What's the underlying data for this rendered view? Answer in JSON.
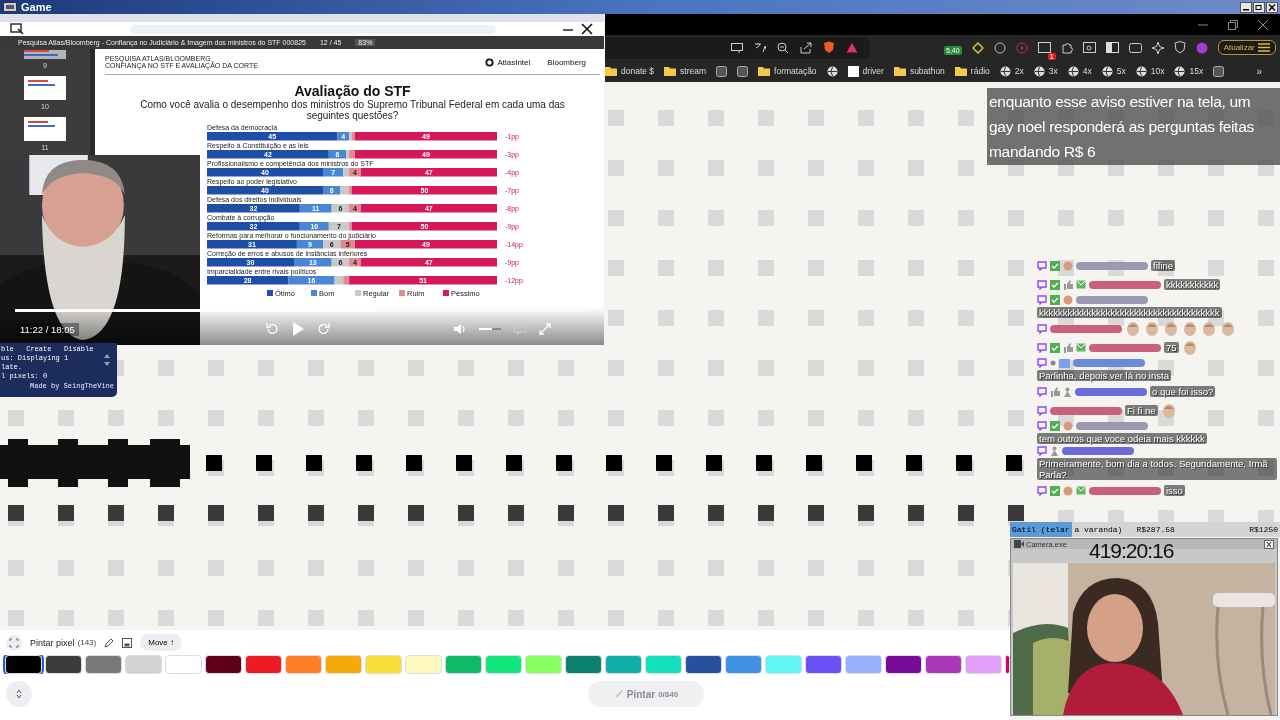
{
  "window": {
    "title": "Game"
  },
  "video": {
    "pdf": {
      "title": "Pesquisa Atlas/Bloomberg - Confiança no Judiciário & Imagem dos ministros do STF 000825",
      "page": "12 / 45",
      "zoom": "83%",
      "thumbnails": [
        {
          "label": "9"
        },
        {
          "label": "10"
        },
        {
          "label": "11"
        }
      ],
      "header_lines": [
        "PESQUISA ATLAS/BLOOMBERG",
        "CONFIANÇA NO STF E AVALIAÇÃO DA CORTE"
      ],
      "brands": [
        {
          "kind": "atlas",
          "label": "AtlasIntel"
        },
        {
          "kind": "plain",
          "label": "Bloomberg"
        }
      ],
      "heading": "Avaliação do STF",
      "subheading": "Como você avalia o desempenho dos ministros do Supremo Tribunal Federal em cada uma das seguintes questões?",
      "chart_data": {
        "type": "bar",
        "orientation": "horizontal",
        "stacked": true,
        "legend": "bottom",
        "categories": [
          "Defesa da democracia",
          "Respeito à Constituição e as leis",
          "Profissionalismo e competência dos ministros do STF",
          "Respeito ao poder legislativo",
          "Defesa dos direitos individuais",
          "Combate à corrupção",
          "Reformas para melhorar o funcionamento do judiciário",
          "Correção de erros e abusos de instâncias inferiores",
          "Imparcialidade entre rivais políticos"
        ],
        "series": [
          {
            "name": "Ótimo",
            "color": "#1e4fa6",
            "values": [
              45,
              42,
              40,
              40,
              32,
              32,
              31,
              30,
              28
            ],
            "value_labels": [
              "45",
              "42",
              "40",
              "40",
              "32",
              "32",
              "31",
              "30",
              "28"
            ]
          },
          {
            "name": "Bom",
            "color": "#4a86d6",
            "values": [
              4,
              6,
              7,
              6,
              11,
              10,
              9,
              13,
              16
            ],
            "value_labels": [
              "4",
              "6",
              "7",
              "6",
              "11",
              "10",
              "9",
              "13",
              "16"
            ]
          },
          {
            "name": "Regular",
            "color": "#c9c9c9",
            "values": [
              1,
              1,
              2,
              3,
              6,
              7,
              6,
              6,
              3
            ],
            "value_labels": [
              null,
              null,
              null,
              null,
              "6",
              "7",
              "6",
              "6",
              null
            ]
          },
          {
            "name": "Ruim",
            "color": "#e0898f",
            "values": [
              1,
              2,
              4,
              1,
              4,
              1,
              5,
              4,
              2
            ],
            "value_labels": [
              null,
              null,
              "4",
              null,
              "4",
              null,
              "5",
              "4",
              null
            ]
          },
          {
            "name": "Péssimo",
            "color": "#d6175a",
            "values": [
              49,
              49,
              47,
              50,
              47,
              50,
              49,
              47,
              51
            ],
            "value_labels": [
              "49",
              "49",
              "47",
              "50",
              "47",
              "50",
              "49",
              "47",
              "51"
            ]
          }
        ],
        "annotations": [
          "-1pp",
          "-3pp",
          "-4pp",
          "-7pp",
          "-8pp",
          "-9pp",
          "-14pp",
          "-9pp",
          "-12pp"
        ]
      }
    },
    "time": "11:22 / 18:05",
    "progress": {
      "level": 0.63
    },
    "volume": {
      "level": 0.6
    }
  },
  "browser": {
    "extension_badge": "5,40",
    "notification_count": "1",
    "update_button": "Atualizar",
    "bookmarks": [
      {
        "kind": "folder",
        "label": "donate $"
      },
      {
        "kind": "folder",
        "label": "stream"
      },
      {
        "kind": "app"
      },
      {
        "kind": "app"
      },
      {
        "kind": "folder",
        "label": "formatação"
      },
      {
        "kind": "globe"
      },
      {
        "kind": "page",
        "label": "driver"
      },
      {
        "kind": "folder",
        "label": "subathon"
      },
      {
        "kind": "folder",
        "label": "rádio"
      },
      {
        "kind": "globe",
        "label": "2x"
      },
      {
        "kind": "globe",
        "label": "3x"
      },
      {
        "kind": "globe",
        "label": "4x"
      },
      {
        "kind": "globe",
        "label": "5x"
      },
      {
        "kind": "globe",
        "label": "10x"
      },
      {
        "kind": "globe",
        "label": "15x"
      },
      {
        "kind": "app"
      }
    ],
    "overflow": "»"
  },
  "notice": "enquanto esse aviso estiver na tela, um gay noel responderá as perguntas feitas mandando R$ 6",
  "chat": [
    {
      "badges": [
        {
          "kind": "twitch"
        },
        {
          "kind": "check"
        },
        {
          "kind": "face"
        }
      ],
      "color": "#9a9ab4",
      "parts": [
        {
          "kind": "text",
          "text": "fifine"
        }
      ]
    },
    {
      "badges": [
        {
          "kind": "twitch"
        },
        {
          "kind": "check"
        },
        {
          "kind": "thumb"
        },
        {
          "kind": "mail"
        }
      ],
      "color": "#c8607e",
      "parts": [
        {
          "kind": "text",
          "text": "kkkkkkkkkkk"
        }
      ]
    },
    {
      "badges": [
        {
          "kind": "twitch"
        },
        {
          "kind": "check"
        },
        {
          "kind": "face"
        }
      ],
      "color": "#9a9ab4",
      "parts": [
        {
          "kind": "text",
          "text": "kkkkkkkkkkkkkkkkkkkkkkkkkkkkkkkkkkkkkk"
        }
      ]
    },
    {
      "badges": [
        {
          "kind": "twitch"
        }
      ],
      "color": "#c8607e",
      "parts": [
        {
          "kind": "emote"
        },
        {
          "kind": "emote"
        },
        {
          "kind": "emote"
        },
        {
          "kind": "emote"
        },
        {
          "kind": "emote"
        },
        {
          "kind": "emote"
        }
      ]
    },
    {
      "badges": [
        {
          "kind": "twitch"
        },
        {
          "kind": "check"
        },
        {
          "kind": "thumb"
        },
        {
          "kind": "mail"
        }
      ],
      "color": "#c8607e",
      "parts": [
        {
          "kind": "text",
          "text": "75"
        },
        {
          "kind": "emote"
        }
      ]
    },
    {
      "badges": [
        {
          "kind": "twitch"
        },
        {
          "kind": "dot"
        },
        {
          "kind": "chat"
        }
      ],
      "color": "#6c8ad8",
      "parts": [
        {
          "kind": "text",
          "text": "Parlinha, depois ver lá no insta"
        }
      ]
    },
    {
      "badges": [
        {
          "kind": "twitch"
        },
        {
          "kind": "thumb"
        },
        {
          "kind": "figure"
        }
      ],
      "color": "#6a6ad8",
      "parts": [
        {
          "kind": "text",
          "text": "o que foi isso?"
        }
      ]
    },
    {
      "badges": [
        {
          "kind": "twitch"
        }
      ],
      "color": "#c8607e",
      "parts": [
        {
          "kind": "text",
          "text": "Fi fi ne"
        },
        {
          "kind": "emote"
        }
      ]
    },
    {
      "badges": [
        {
          "kind": "twitch"
        },
        {
          "kind": "check"
        },
        {
          "kind": "face"
        }
      ],
      "color": "#9a9ab4",
      "parts": [
        {
          "kind": "text",
          "text": "tem outros que voce odeia mais kkkkkk"
        }
      ]
    },
    {
      "badges": [
        {
          "kind": "twitch"
        },
        {
          "kind": "figure"
        }
      ],
      "color": "#6a6ad8",
      "parts": [
        {
          "kind": "text",
          "text": "Primeiramente, bom dia a todos. Segundamente, Irmã Parla?"
        }
      ]
    },
    {
      "badges": [
        {
          "kind": "twitch"
        },
        {
          "kind": "check"
        },
        {
          "kind": "face"
        },
        {
          "kind": "mail"
        }
      ],
      "color": "#c8607e",
      "parts": [
        {
          "kind": "text",
          "text": "isso"
        }
      ]
    }
  ],
  "script_panel": {
    "lines": [
      "ble   Create   Disable",
      "us: Displaying 1",
      "late.",
      "l pixels: 0"
    ],
    "credit": "Made by SeingTheVine"
  },
  "paint_bar": {
    "mode": "Pintar pixel",
    "count": "(143)",
    "move_button": "Move ↑",
    "swatches": [
      {
        "color": "#000000",
        "selected": true
      },
      {
        "color": "#3c3c3c",
        "selected": false
      },
      {
        "color": "#787878",
        "selected": false
      },
      {
        "color": "#d2d2d2",
        "selected": false
      },
      {
        "color": "#ffffff",
        "selected": false
      },
      {
        "color": "#600018",
        "selected": false
      },
      {
        "color": "#ed1c24",
        "selected": false
      },
      {
        "color": "#ff7f27",
        "selected": false
      },
      {
        "color": "#f6aa09",
        "selected": false
      },
      {
        "color": "#f9dd3b",
        "selected": false
      },
      {
        "color": "#fffabc",
        "selected": false
      },
      {
        "color": "#0eb968",
        "selected": false
      },
      {
        "color": "#13e67b",
        "selected": false
      },
      {
        "color": "#87ff5e",
        "selected": false
      },
      {
        "color": "#0c816e",
        "selected": false
      },
      {
        "color": "#10aea6",
        "selected": false
      },
      {
        "color": "#13e1be",
        "selected": false
      },
      {
        "color": "#28509e",
        "selected": false
      },
      {
        "color": "#4093e4",
        "selected": false
      },
      {
        "color": "#60f7f2",
        "selected": false
      },
      {
        "color": "#6b50f6",
        "selected": false
      },
      {
        "color": "#99b1fb",
        "selected": false
      },
      {
        "color": "#780c99",
        "selected": false
      },
      {
        "color": "#aa38b9",
        "selected": false
      },
      {
        "color": "#e09ff9",
        "selected": false
      },
      {
        "color": "#cb007a",
        "selected": false
      }
    ],
    "paint_button": {
      "label": "Pintar",
      "count": "0/840",
      "disabled": true
    }
  },
  "goal": {
    "label": "Gatil (telar a varanda)",
    "level": 0.23,
    "current": "R$287.58",
    "target": "R$1250"
  },
  "camera": {
    "title": "Camera.exe",
    "timer": "419:20:16"
  }
}
